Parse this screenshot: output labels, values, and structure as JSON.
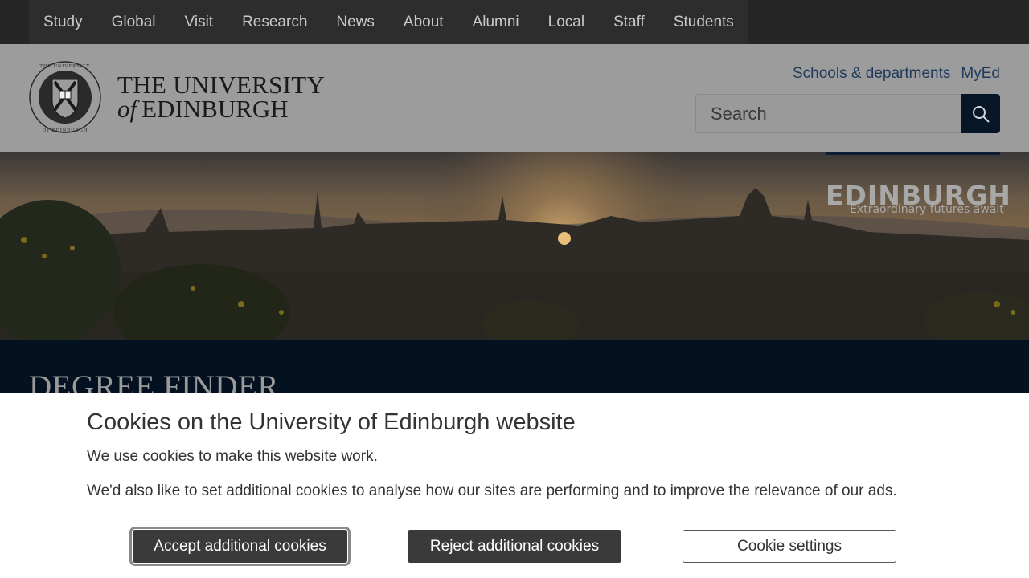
{
  "top_nav": {
    "items": [
      "Study",
      "Global",
      "Visit",
      "Research",
      "News",
      "About",
      "Alumni",
      "Local",
      "Staff",
      "Students"
    ]
  },
  "header": {
    "logo_line1": "THE UNIVERSITY",
    "logo_of": "of",
    "logo_line2": "EDINBURGH",
    "util_links": [
      "Schools & departments",
      "MyEd"
    ],
    "search_placeholder": "Search",
    "search_icon": "search-icon"
  },
  "hero": {
    "brand_title": "EDINBURGH",
    "brand_tagline": "Extraordinary futures await"
  },
  "band": {
    "title": "DEGREE FINDER"
  },
  "cookie_banner": {
    "title": "Cookies on the University of Edinburgh website",
    "text1": "We use cookies to make this website work.",
    "text2": "We'd also like to set additional cookies to analyse how our sites are performing and to improve the relevance of our ads.",
    "accept_label": "Accept additional cookies",
    "reject_label": "Reject additional cookies",
    "settings_label": "Cookie settings"
  },
  "colors": {
    "nav_bg": "#262626",
    "dark_navy": "#031120",
    "link_blue": "#1f3a5c",
    "button_dark": "#3a3a3a"
  }
}
